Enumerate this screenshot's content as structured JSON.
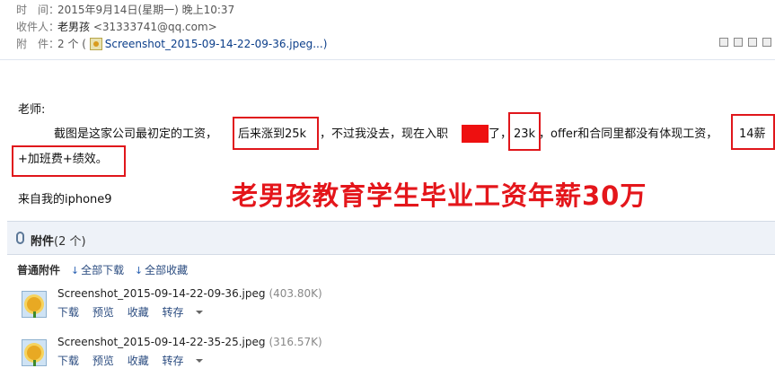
{
  "header": {
    "time_label": "时　间：",
    "time_value": "2015年9月14日(星期一) 晚上10:37",
    "recipient_label": "收件人：",
    "recipient_name": "老男孩",
    "recipient_email": "<31333741@qq.com>",
    "attach_label": "附　件：",
    "attach_count": "2 个 (",
    "attach_file": "Screenshot_2015-09-14-22-09-36.jpeg...)"
  },
  "message": {
    "greeting": "老师:",
    "line1": {
      "a": "截图是这家公司最初定的工资，",
      "b": "后来涨到25k",
      "c": "，不过我没去，现在入职",
      "d": "了，",
      "e": "23k",
      "f": "，offer和合同里都没有体现工资，",
      "g": "14薪"
    },
    "line2": "+加班费+绩效。",
    "signature": "来自我的iphone9"
  },
  "slogan": "老男孩教育学生毕业工资年薪30万",
  "attachments": {
    "title_bold": "附件",
    "title_count": "(2 个)",
    "normal_label": "普通附件",
    "download_all": "全部下载",
    "save_all": "全部收藏",
    "files": [
      {
        "name": "Screenshot_2015-09-14-22-09-36.jpeg",
        "size": "(403.80K)"
      },
      {
        "name": "Screenshot_2015-09-14-22-35-25.jpeg",
        "size": "(316.57K)"
      }
    ],
    "actions": {
      "download": "下载",
      "preview": "预览",
      "save": "收藏",
      "forward": "转存"
    }
  },
  "colors": {
    "highlight": "#e0161b",
    "slogan": "#e4161b",
    "link": "#2b4c80"
  }
}
